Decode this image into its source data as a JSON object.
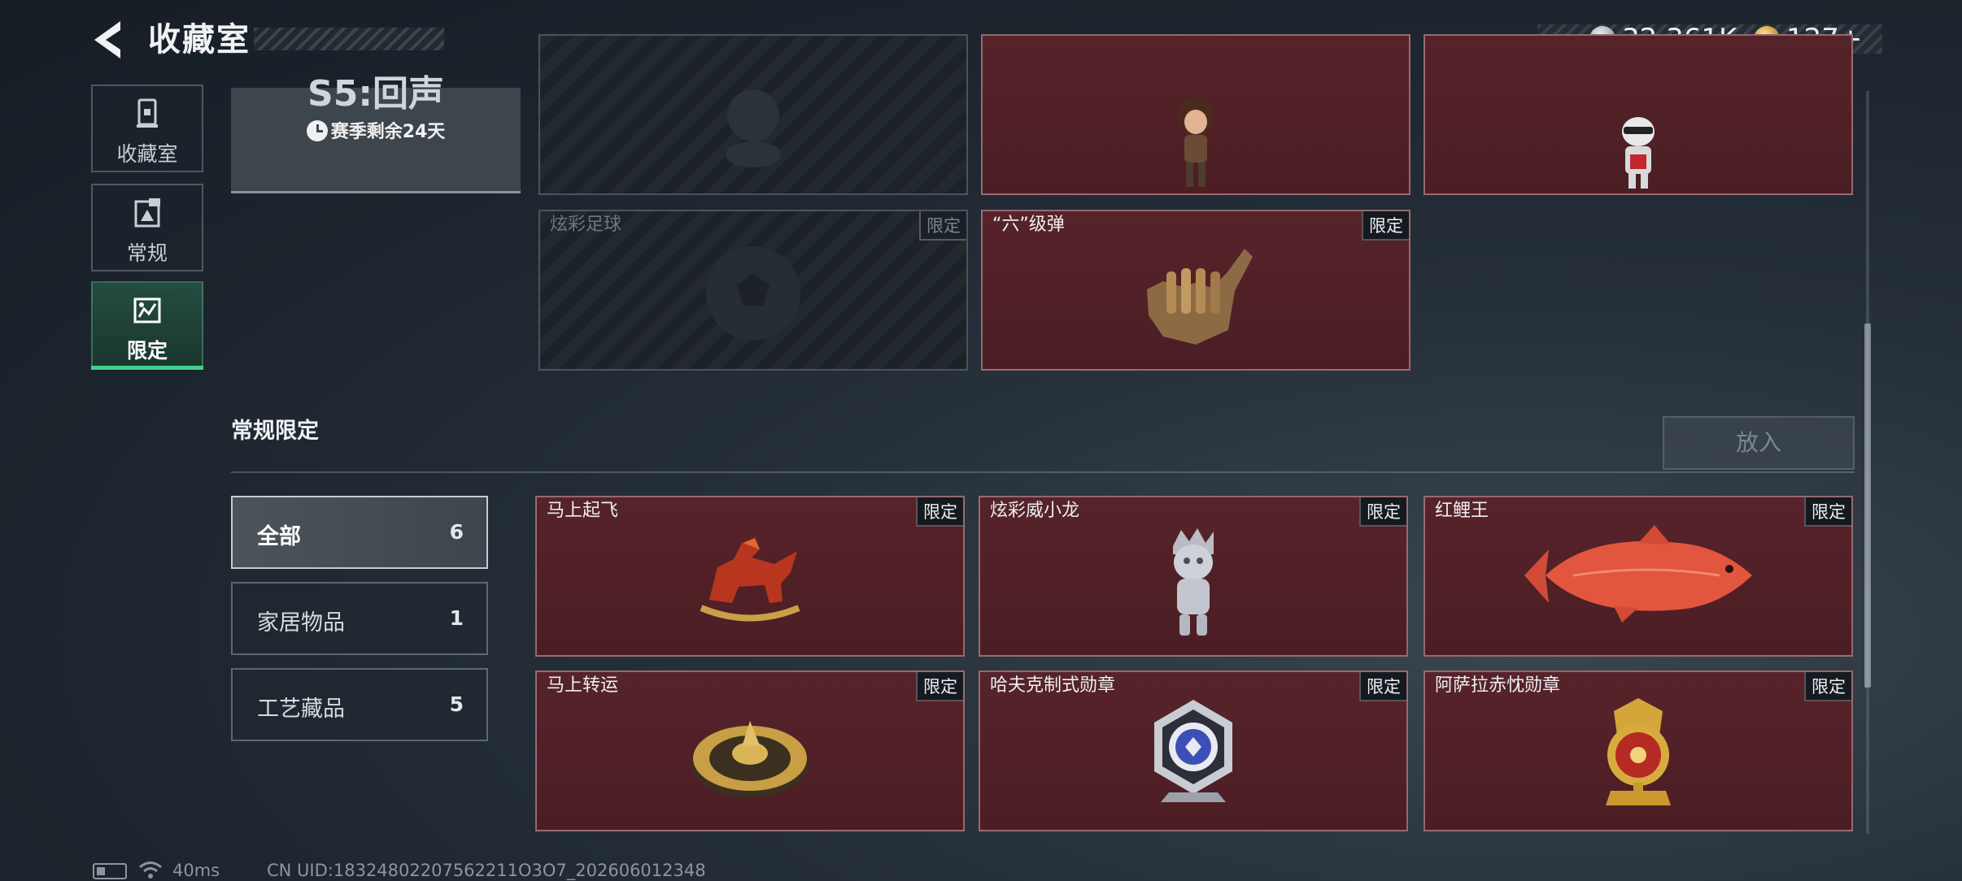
{
  "header": {
    "title": "收藏室",
    "currency": [
      {
        "icon": "silver-coin-icon",
        "value": "32,361K"
      },
      {
        "icon": "gold-coin-icon",
        "value": "127+"
      }
    ]
  },
  "nav": {
    "items": [
      {
        "label": "收藏室",
        "icon": "trophy-display-icon",
        "active": false
      },
      {
        "label": "常规",
        "icon": "picture-frame-icon",
        "active": false
      },
      {
        "label": "限定",
        "icon": "limited-gallery-icon",
        "active": true
      }
    ]
  },
  "season": {
    "name": "S5:回声",
    "remaining": "赛季剩余24天"
  },
  "top_items": [
    {
      "name": "",
      "badge": "",
      "locked": true,
      "icon": "figure-silhouette-icon"
    },
    {
      "name": "",
      "badge": "",
      "locked": false,
      "icon": "girl-figurine-icon"
    },
    {
      "name": "",
      "badge": "",
      "locked": false,
      "icon": "robot-figurine-icon"
    },
    {
      "name": "炫彩足球",
      "badge": "限定",
      "locked": true,
      "icon": "soccer-ball-icon"
    },
    {
      "name": "“六”级弹",
      "badge": "限定",
      "locked": false,
      "icon": "bullet-hand-sculpture-icon"
    }
  ],
  "section": {
    "title": "常规限定",
    "place_button": "放入"
  },
  "filters": [
    {
      "label": "全部",
      "count": "6",
      "active": true
    },
    {
      "label": "家居物品",
      "count": "1",
      "active": false
    },
    {
      "label": "工艺藏品",
      "count": "5",
      "active": false
    }
  ],
  "items": [
    {
      "name": "马上起飞",
      "badge": "限定",
      "icon": "rocking-horse-icon"
    },
    {
      "name": "炫彩威小龙",
      "badge": "限定",
      "icon": "dragon-figurine-icon"
    },
    {
      "name": "红鲤王",
      "badge": "限定",
      "icon": "red-carp-icon"
    },
    {
      "name": "马上转运",
      "badge": "限定",
      "icon": "fortune-wheel-icon"
    },
    {
      "name": "哈夫克制式勋章",
      "badge": "限定",
      "icon": "silver-medal-icon"
    },
    {
      "name": "阿萨拉赤忱勋章",
      "badge": "限定",
      "icon": "gold-medal-icon"
    }
  ],
  "status_bar": {
    "ping": "40ms",
    "uid": "CN UID:18324802207562211O3O7_202606012348"
  },
  "colors": {
    "accent_green": "#3fd18f",
    "card_red": "#57232a",
    "badge_bg": "#141a20"
  }
}
